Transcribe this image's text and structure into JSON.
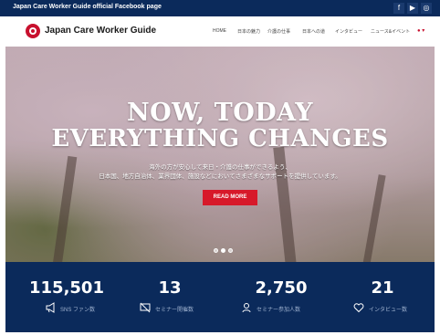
{
  "topbar": {
    "title": "Japan Care Worker Guide official Facebook page",
    "social": [
      {
        "icon": "facebook-icon",
        "glyph": "f"
      },
      {
        "icon": "youtube-icon",
        "glyph": "▶"
      },
      {
        "icon": "instagram-icon",
        "glyph": "◎"
      }
    ]
  },
  "header": {
    "logo_text": "Japan Care Worker Guide",
    "nav": [
      {
        "label": "HOME"
      },
      {
        "label": "日本の魅力"
      },
      {
        "label": "介護の仕事"
      },
      {
        "label": "日本への道"
      },
      {
        "label": "インタビュー"
      },
      {
        "label": "ニュース&イベント"
      }
    ],
    "lang": "● ▾"
  },
  "hero": {
    "title_line1": "NOW, TODAY",
    "title_line2": "EVERYTHING CHANGES",
    "subtitle_line1": "海外の方が安心して来日・介護の仕事ができるよう、",
    "subtitle_line2": "日本国、地方自治体、業界団体、施設などにおいてさまざまなサポートを提供しています。",
    "cta_label": "READ MORE",
    "slides": 3,
    "active_slide": 2
  },
  "stats": [
    {
      "value": "115,501",
      "label": "SNS ファン数",
      "icon": "megaphone-icon"
    },
    {
      "value": "13",
      "label": "セミナー開催数",
      "icon": "seminar-icon"
    },
    {
      "value": "2,750",
      "label": "セミナー参加人数",
      "icon": "person-icon"
    },
    {
      "value": "21",
      "label": "インタビュー数",
      "icon": "heart-icon"
    }
  ],
  "colors": {
    "navy": "#0b2a5b",
    "accent_red": "#d7192a"
  }
}
